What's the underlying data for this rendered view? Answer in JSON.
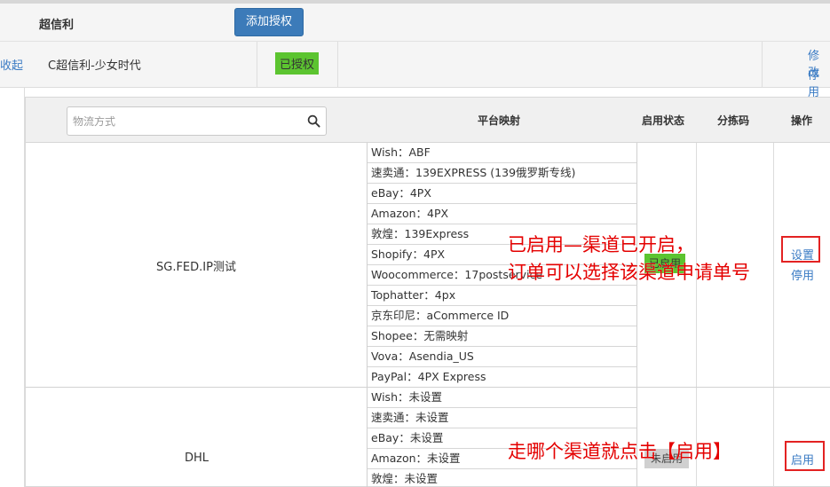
{
  "header": {
    "title": "超信利",
    "add_button": "添加授权"
  },
  "account": {
    "collapse": "收起",
    "name": "C超信利-少女时代",
    "auth_status": "已授权",
    "edit": "修改",
    "disable": "停用"
  },
  "table": {
    "search_placeholder": "物流方式",
    "col_mapping": "平台映射",
    "col_status": "启用状态",
    "col_sort_code": "分拣码",
    "col_action": "操作",
    "rows": [
      {
        "name": "SG.FED.IP测试",
        "mappings": [
          "Wish：ABF",
          "速卖通：139EXPRESS (139俄罗斯专线)",
          "eBay：4PX",
          "Amazon：4PX",
          "敦煌：139Express",
          "Shopify：4PX",
          "Woocommerce：17postservice",
          "Tophatter：4px",
          "京东印尼：aCommerce ID",
          "Shopee：无需映射",
          "Vova：Asendia_US",
          "PayPal：4PX Express"
        ],
        "status": "已启用",
        "action_primary": "设置",
        "action_secondary": "停用"
      },
      {
        "name": "DHL",
        "mappings": [
          "Wish：未设置",
          "速卖通：未设置",
          "eBay：未设置",
          "Amazon：未设置",
          "敦煌：未设置"
        ],
        "status": "未启用",
        "action_primary": "启用"
      }
    ]
  },
  "annotations": {
    "enabled_line1": "已启用—渠道已开启，",
    "enabled_line2": "订单可以选择该渠道申请单号",
    "enable_hint": "走哪个渠道就点击【启用】"
  },
  "colors": {
    "primary_button": "#3c7bb9",
    "enabled_green": "#5cc430",
    "link_blue": "#3a7bc4",
    "annotation_red": "#e40000"
  }
}
